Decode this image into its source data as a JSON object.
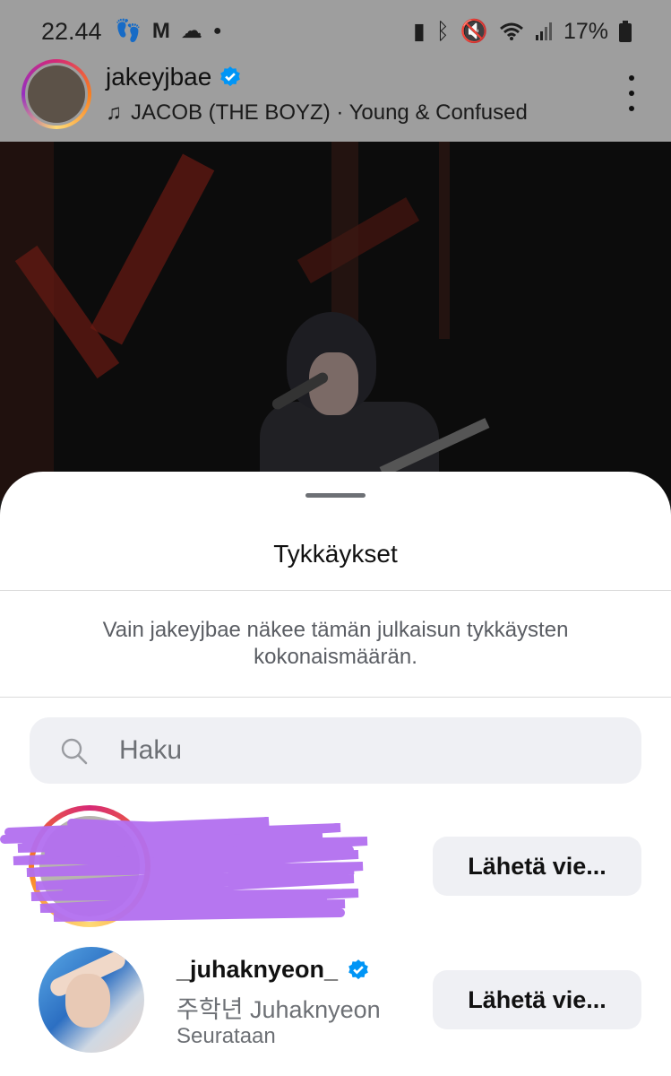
{
  "status_bar": {
    "time": "22.44",
    "battery": "17%",
    "left_icons": [
      "footsteps-icon",
      "gmail-icon",
      "cloud-icon",
      "dot-icon"
    ],
    "right_icons": [
      "battery-saver-icon",
      "bluetooth-icon",
      "mute-icon",
      "wifi-icon",
      "signal-icon",
      "battery-icon"
    ]
  },
  "post": {
    "username": "jakeyjbae",
    "music": "JACOB (THE BOYZ) · Young & Confused"
  },
  "sheet": {
    "title": "Tykkäykset",
    "notice": "Vain jakeyjbae näkee tämän julkaisun tykkäysten kokonaismäärän.",
    "search_placeholder": "Haku"
  },
  "likes": [
    {
      "username": "",
      "redacted": true,
      "button": "Lähetä vie..."
    },
    {
      "username": "_juhaknyeon_",
      "full_name": "주학년 Juhaknyeon",
      "status": "Seurataan",
      "verified": true,
      "button": "Lähetä vie..."
    }
  ],
  "colors": {
    "accent_verified": "#0095f6",
    "redaction": "#b36ff0",
    "button_bg": "#eff0f4"
  }
}
